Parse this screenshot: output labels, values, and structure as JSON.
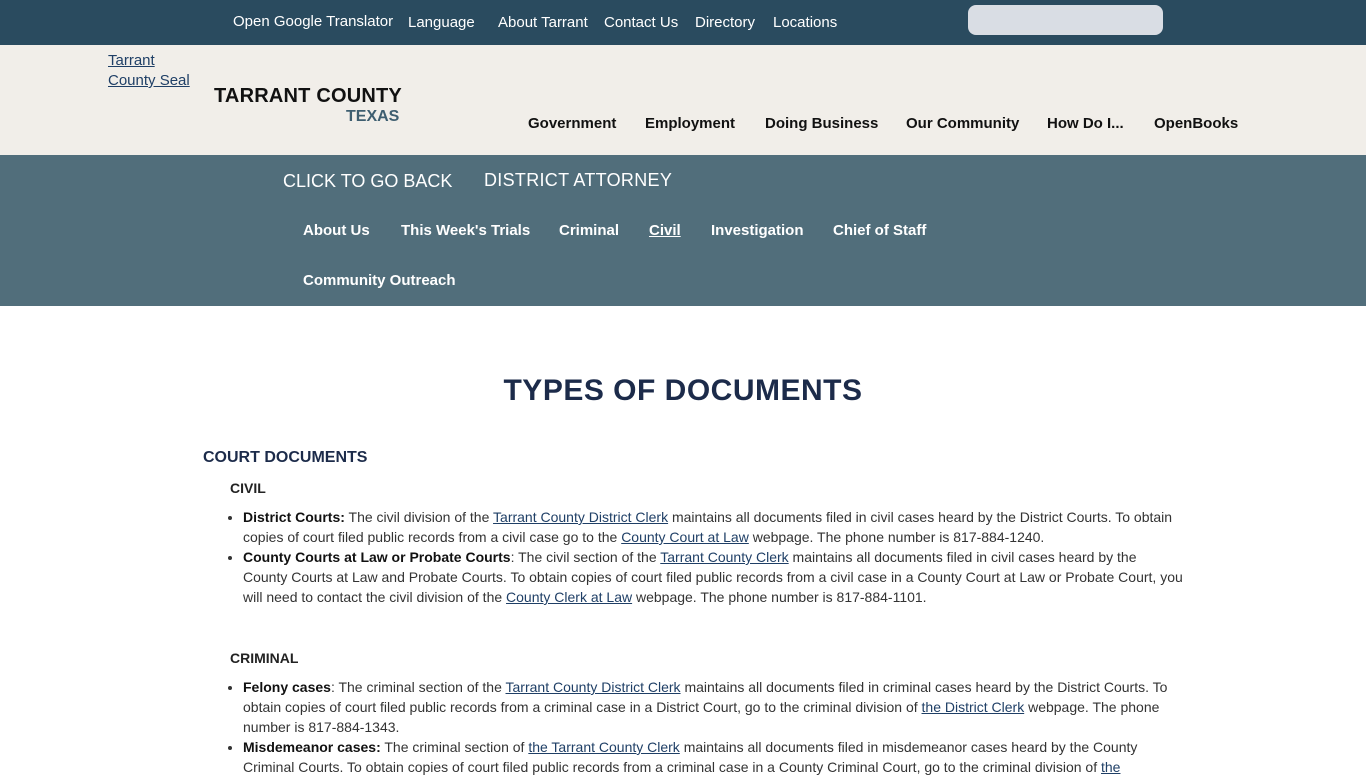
{
  "utility": {
    "translator_alt": "Open Google Translator",
    "links": [
      "Language",
      "About Tarrant",
      "Contact Us",
      "Directory",
      "Locations"
    ],
    "search_placeholder": ""
  },
  "header": {
    "seal_alt": "Tarrant County Seal",
    "county": "TARRANT COUNTY",
    "state": "TEXAS",
    "nav": [
      "Government",
      "Employment",
      "Doing Business",
      "Our Community",
      "How Do I...",
      "OpenBooks"
    ]
  },
  "department": {
    "back_alt": "Click to go back",
    "name": "DISTRICT ATTORNEY",
    "nav": [
      "About Us",
      "This Week's Trials",
      "Criminal",
      "Civil",
      "Investigation",
      "Chief of Staff",
      "Community Outreach"
    ],
    "active": "Civil"
  },
  "content": {
    "title": "TYPES OF DOCUMENTS",
    "section": "COURT DOCUMENTS",
    "civil": {
      "heading": "CIVIL",
      "items": [
        {
          "label": "District Courts:",
          "t1": " The civil division of the ",
          "l1": "Tarrant County District Clerk",
          "t2": " maintains all documents filed in civil cases heard by the District Courts. To obtain copies of court filed public records from a civil case go to the ",
          "l2": "County Court at Law",
          "t3": " webpage.  The phone number is 817-884-1240."
        },
        {
          "label": "County Courts at Law or Probate Courts",
          "t1": ": The civil section of the ",
          "l1": "Tarrant County Clerk",
          "t2": " maintains all documents filed in civil cases heard by the County Courts at Law and Probate Courts. To obtain copies of court filed public records from a civil case in a County Court at Law or Probate Court, you will need to contact the civil division of the ",
          "l2": "County Clerk at Law",
          "t3": " webpage.  The phone number is 817-884-1101."
        }
      ]
    },
    "criminal": {
      "heading": "CRIMINAL",
      "items": [
        {
          "label": "Felony cases",
          "t1": ": The criminal section of the ",
          "l1": "Tarrant County District Clerk",
          "t2": " maintains all documents filed in criminal cases heard by the District Courts. To obtain copies of court filed public records from a criminal case in a District Court, go to the criminal division of ",
          "l2": "the District Clerk",
          "t3": " webpage.  The phone number is 817-884-1343."
        },
        {
          "label": "Misdemeanor cases:",
          "t1": " The criminal section of ",
          "l1": "the Tarrant County Clerk",
          "t2": " maintains all documents filed in misdemeanor cases heard by the County Criminal Courts. To obtain copies of court filed public records from a criminal case in a County Criminal Court, go to the criminal division of ",
          "l2": "the",
          "t3": ""
        }
      ]
    }
  }
}
